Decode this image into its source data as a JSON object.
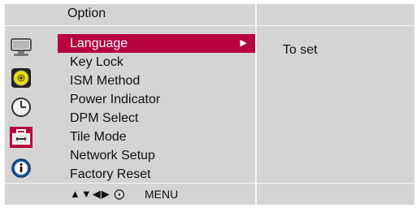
{
  "header": {
    "title": "Option"
  },
  "menu": {
    "items": [
      {
        "label": "Language",
        "selected": true,
        "arrow": "▶"
      },
      {
        "label": "Key Lock"
      },
      {
        "label": "ISM Method"
      },
      {
        "label": "Power Indicator"
      },
      {
        "label": "DPM Select"
      },
      {
        "label": "Tile Mode"
      },
      {
        "label": "Network Setup"
      },
      {
        "label": "Factory Reset"
      }
    ]
  },
  "description": {
    "text": "To set"
  },
  "footer": {
    "nav_symbols": "▲▼◀▶ ⨀",
    "menu_label": "MENU"
  },
  "icons": [
    "monitor-icon",
    "audio-disc-icon",
    "clock-icon",
    "toolbox-icon",
    "info-icon"
  ],
  "colors": {
    "selected": "#b7013c",
    "panel": "#d4d4d4",
    "separator": "#f4f4f4"
  }
}
